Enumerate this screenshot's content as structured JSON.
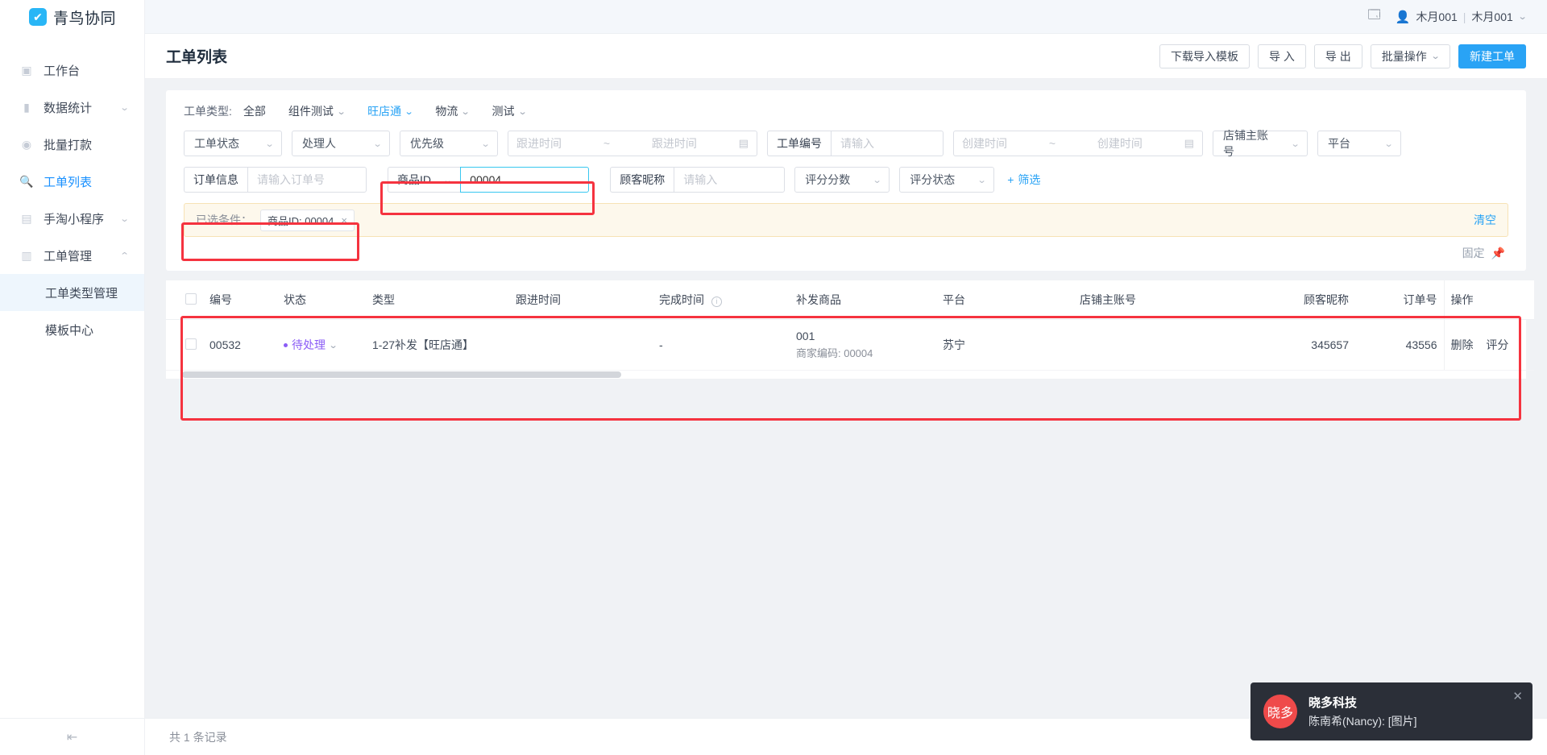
{
  "brand": {
    "name": "青鸟协同",
    "logo_icon": "check-circle-icon",
    "logo_color": "#29b6f6"
  },
  "sidebar": {
    "items": [
      {
        "label": "工作台",
        "icon": "workbench-icon",
        "expandable": false,
        "active": false
      },
      {
        "label": "数据统计",
        "icon": "bar-chart-icon",
        "expandable": true,
        "active": false
      },
      {
        "label": "批量打款",
        "icon": "coin-icon",
        "expandable": false,
        "active": false
      },
      {
        "label": "工单列表",
        "icon": "search-icon",
        "expandable": false,
        "active": true
      },
      {
        "label": "手淘小程序",
        "icon": "clipboard-icon",
        "expandable": true,
        "active": false
      },
      {
        "label": "工单管理",
        "icon": "note-icon",
        "expandable": true,
        "active": false,
        "expanded": true
      }
    ],
    "sub_items": [
      {
        "label": "工单类型管理",
        "selected": true
      },
      {
        "label": "模板中心",
        "selected": false
      }
    ],
    "collapse_icon": "collapse-sidebar-icon"
  },
  "topbar": {
    "app_icon": "app-switch-icon",
    "user_icon": "user-icon",
    "user_name": "木月001",
    "user_divider": "|",
    "user_org": "木月001",
    "chevron": "chevron-down-icon"
  },
  "page": {
    "title": "工单列表"
  },
  "head_actions": [
    {
      "label": "下载导入模板",
      "type": "default",
      "has_chevron": false
    },
    {
      "label": "导 入",
      "type": "default",
      "has_chevron": false
    },
    {
      "label": "导 出",
      "type": "default",
      "has_chevron": false
    },
    {
      "label": "批量操作",
      "type": "default",
      "has_chevron": true
    },
    {
      "label": "新建工单",
      "type": "primary",
      "has_chevron": false
    }
  ],
  "filters": {
    "type_label": "工单类型:",
    "types": [
      {
        "label": "全部",
        "active": false,
        "has_chevron": false
      },
      {
        "label": "组件测试",
        "active": false,
        "has_chevron": true
      },
      {
        "label": "旺店通",
        "active": true,
        "has_chevron": true
      },
      {
        "label": "物流",
        "active": false,
        "has_chevron": true
      },
      {
        "label": "测试",
        "active": false,
        "has_chevron": true
      }
    ],
    "row1": {
      "status_select": "工单状态",
      "handler_select": "处理人",
      "priority_select": "优先级",
      "follow_date_start": "跟进时间",
      "follow_date_sep": "~",
      "follow_date_end": "跟进时间",
      "follow_cal_icon": "calendar-icon",
      "order_no_addon": "工单编号",
      "order_no_placeholder": "请输入",
      "order_no_value": "",
      "create_date_start": "创建时间",
      "create_date_sep": "~",
      "create_date_end": "创建时间",
      "create_cal_icon": "calendar-icon",
      "shop_account_select": "店铺主账号",
      "platform_select": "平台"
    },
    "row2": {
      "order_info_addon": "订单信息",
      "order_info_placeholder": "请输入订单号",
      "order_info_value": "",
      "goods_id_addon": "商品ID",
      "goods_id_value": "00004",
      "goods_id_placeholder": "请输入",
      "nickname_addon": "顾客昵称",
      "nickname_placeholder": "请输入",
      "nickname_value": "",
      "score_select": "评分分数",
      "score_status_select": "评分状态",
      "more_filter": "筛选",
      "more_filter_plus": "+"
    },
    "selected": {
      "label": "已选条件：",
      "tags": [
        {
          "text": "商品ID: 00004",
          "close": "×"
        }
      ],
      "clear_label": "清空"
    },
    "pin": {
      "label": "固定",
      "icon": "pin-icon"
    }
  },
  "table": {
    "columns": [
      "编号",
      "状态",
      "类型",
      "跟进时间",
      "完成时间",
      "补发商品",
      "平台",
      "店铺主账号",
      "顾客昵称",
      "订单号",
      "操作"
    ],
    "finish_time_info_icon": "info-icon",
    "rows": [
      {
        "id": "00532",
        "status": "待处理",
        "status_color": "#8b5cf6",
        "type": "1-27补发【旺店通】",
        "follow_time": "",
        "finish_time": "-",
        "goods_name": "001",
        "goods_code": "商家编码: 00004",
        "platform": "苏宁",
        "shop_account": "",
        "nickname": "345657",
        "order_no": "43556",
        "actions": [
          "删除",
          "评分"
        ]
      }
    ]
  },
  "footer": {
    "record_count": "共 1 条记录"
  },
  "toast": {
    "avatar_text": "晓多",
    "title": "晓多科技",
    "message": "陈南希(Nancy): [图片]",
    "close_icon": "close-icon",
    "avatar_color": "#ef4a4a"
  }
}
